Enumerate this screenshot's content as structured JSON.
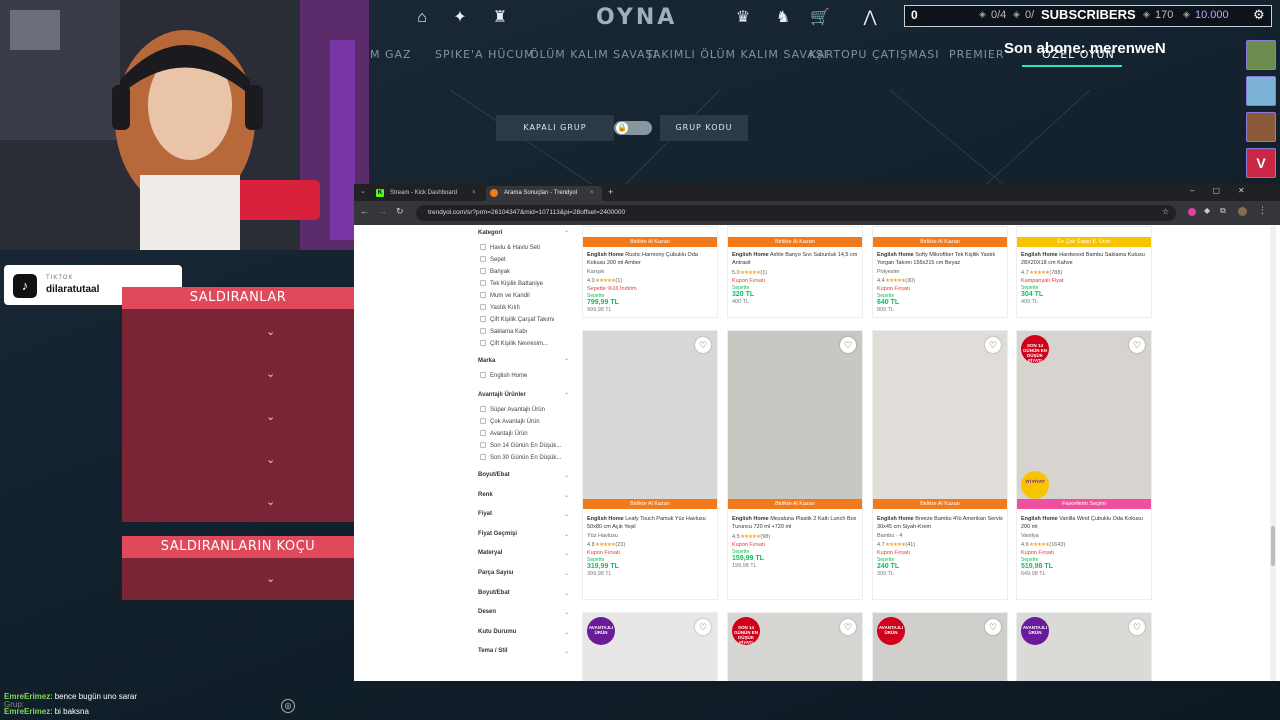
{
  "game": {
    "title": "OYNA",
    "modes": [
      "M GAZ",
      "SPIKE'A HÜCUM",
      "ÖLÜM KALIM SAVAŞI",
      "TAKIMLI ÖLÜM KALIM SAVAŞI",
      "KARTOPU ÇATIŞMASI",
      "PREMIER",
      "ÖZEL OYUN"
    ],
    "party": {
      "closed": "KAPALI GRUP",
      "code": "GRUP KODU"
    },
    "nav_icons": [
      "home-icon",
      "crosshair-icon",
      "agent-icon",
      "rank-icon",
      "career-icon",
      "store-icon",
      "battlepass-icon"
    ]
  },
  "overlay": {
    "sub_count": "0",
    "progress": "0/4",
    "goal_current": "0/",
    "subscribers_label": "SUBSCRIBERS",
    "rr": "170",
    "vp": "10.000",
    "last_sub": "Son abone: merenweN"
  },
  "tiktok": {
    "label": "TIKTOK",
    "name": "dilaratutaal"
  },
  "panels": {
    "attackers": "SALDIRANLAR",
    "attackers_coach": "SALDIRANLARIN KOÇU"
  },
  "chat": [
    {
      "user": "EmreErimez",
      "msg": ": bence bugün uno sarar"
    },
    {
      "user": "EmreErimez",
      "msg": ": bi baksna"
    }
  ],
  "chat_overlay_text": "Grup:",
  "browser": {
    "tabs": [
      "Stream - Kick Dashboard",
      "Arama Sonuçları - Trendyol"
    ],
    "new_tab": "+",
    "url": "trendyol.com/sr?prm=26104347&mid=107113&pi=28offset=2400000"
  },
  "sidebar": {
    "category_title": "Kategori",
    "categories": [
      "Havlu & Havlu Seti",
      "Sepet",
      "Banyak",
      "Tek Kişilik Battaniye",
      "Mum ve Kandil",
      "Yastık Kılıfı",
      "Çift Kişilik Çarşaf Takımı",
      "Saklama Kabı",
      "Çift Kişilik Nevresim..."
    ],
    "brand_title": "Marka",
    "brands": [
      "English Home"
    ],
    "adv_title": "Avantajlı Ürünler",
    "advs": [
      "Süper Avantajlı Ürün",
      "Çok Avantajlı Ürün",
      "Avantajlı Ürün",
      "Son 14 Günün En Düşük...",
      "Son 30 Günün En Düşük..."
    ],
    "filters": [
      "Boyut/Ebat",
      "Renk",
      "Fiyat",
      "Fiyat Geçmişi",
      "Materyal",
      "Parça Sayısı",
      "Boyut/Ebat",
      "Desen",
      "Kutu Durumu",
      "Tema / Stil"
    ]
  },
  "products_row1": [
    {
      "promo": "Birlikte Al Kazan",
      "brand": "English Home",
      "title": "Rustic Harmony Çubuklu Oda Kokusu 200 ml Amber",
      "sub": "Karışık",
      "rating": "4.0",
      "count": "(1)",
      "tag": "Sepette %16 İndirim",
      "price": "799,99 TL",
      "price_label": "Sepette",
      "old": "999,98 TL"
    },
    {
      "promo": "Birlikte Al Kazan",
      "brand": "English Home",
      "title": "Ashle Banyo Sıvı Sabunluk 14,5 cm Antrasit",
      "sub": "",
      "rating": "5.0",
      "count": "(1)",
      "tag": "Kupon Fırsatı",
      "price": "320 TL",
      "price_label": "Sepette",
      "old": "400 TL"
    },
    {
      "promo": "Birlikte Al Kazan",
      "brand": "English Home",
      "title": "Softy Mikrofiber Tek Kişilik Yastık Yorgan Takımı 155x215 cm Beyaz",
      "sub": "Polyester",
      "rating": "4.4",
      "count": "(30)",
      "tag": "Kupon Fırsatı",
      "price": "640 TL",
      "price_label": "Sepette",
      "old": "800 TL"
    },
    {
      "promo": "En Çok Satan 6. Ürün",
      "brand": "English Home",
      "title": "Hardwood Bambu Saklama Kutusu 28X20X18 cm Kahve",
      "sub": "",
      "rating": "4.7",
      "count": "(788)",
      "tag": "Kampanyalı Fiyat",
      "price": "304 TL",
      "price_label": "Sepette",
      "old": "400 TL"
    }
  ],
  "products_row2": [
    {
      "promo": "Birlikte Al Kazan",
      "brand": "English Home",
      "title": "Leafy Touch Pamuk Yüz Havlusu 50x80 cm Açık Yeşil",
      "sub": "Yüz Havlusu",
      "rating": "4.8",
      "count": "(23)",
      "tag": "Kupon Fırsatı",
      "price": "319,99 TL",
      "price_label": "Sepette",
      "old": "399,98 TL"
    },
    {
      "promo": "Birlikte Al Kazan",
      "brand": "English Home",
      "title": "Mezaluna Plastik 2 Katlı Lunch Box Turuncu 720 ml +720 ml",
      "sub": "",
      "rating": "4.5",
      "count": "(98)",
      "tag": "Kupon Fırsatı",
      "price": "159,99 TL",
      "price_label": "Sepette",
      "old": "199,98 TL"
    },
    {
      "promo": "Birlikte Al Kazan",
      "brand": "English Home",
      "title": "Breeze Bambu 4'lü Amerikan Servis 30x45 cm Siyah-Krem",
      "sub": "Bambu · 4",
      "rating": "4.7",
      "count": "(41)",
      "tag": "Kupon Fırsatı",
      "price": "240 TL",
      "price_label": "Sepette",
      "old": "300 TL"
    },
    {
      "promo": "Favorilerin Seçimi",
      "brand": "English Home",
      "title": "Vanilla Wind Çubuklu Oda Kokusu 200 ml",
      "sub": "Vanilya",
      "rating": "4.6",
      "count": "(1643)",
      "tag": "Kupon Fırsatı",
      "price": "519,98 TL",
      "price_label": "Sepette",
      "old": "649,98 TL"
    }
  ],
  "badges": {
    "low14": "SON 14 GÜNÜN EN DÜŞÜK FİYATI",
    "good_price": "İYİ FİYAT",
    "advantage": "AVANTAJLI ÜRÜN"
  },
  "colors": {
    "accent_orange": "#f27a1a",
    "panel_red": "#e0485c",
    "valorant_teal": "#2de2c6"
  }
}
